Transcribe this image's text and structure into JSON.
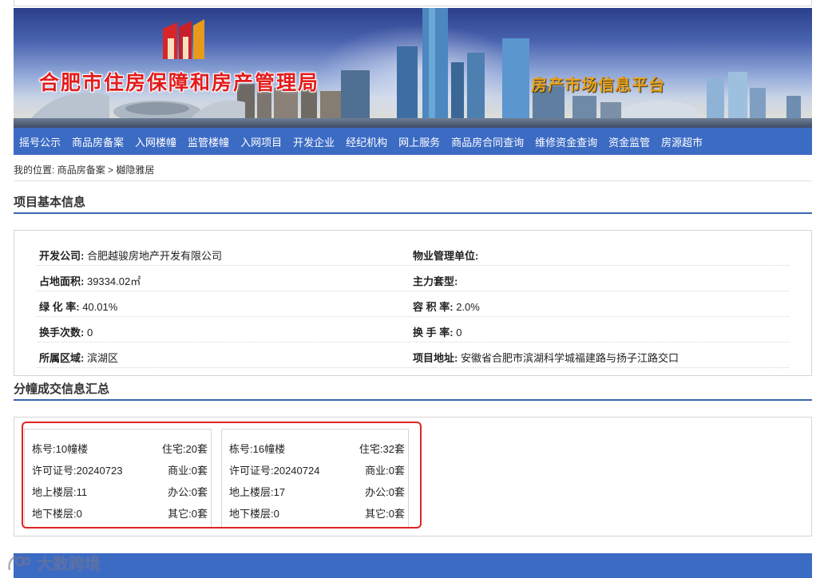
{
  "banner": {
    "title": "合肥市住房保障和房产管理局",
    "subtitle": "房产市场信息平台"
  },
  "nav": [
    "摇号公示",
    "商品房备案",
    "入网楼幢",
    "监管楼幢",
    "入网项目",
    "开发企业",
    "经纪机构",
    "网上服务",
    "商品房合同查询",
    "维修资金查询",
    "资金监管",
    "房源超市"
  ],
  "breadcrumb": {
    "prefix": "我的位置:",
    "item1": "商品房备案",
    "sep": ">",
    "item2": "樾隐雅居"
  },
  "section1": {
    "title": "项目基本信息"
  },
  "info": [
    {
      "left_label": "开发公司:",
      "left_value": "合肥越骏房地产开发有限公司",
      "right_label": "物业管理单位:",
      "right_value": ""
    },
    {
      "left_label": "占地面积:",
      "left_value": "39334.02㎡",
      "right_label": "主力套型:",
      "right_value": ""
    },
    {
      "left_label": "绿 化 率:",
      "left_value": "40.01%",
      "right_label": "容 积 率:",
      "right_value": "2.0%"
    },
    {
      "left_label": "换手次数:",
      "left_value": "0",
      "right_label": "换 手 率:",
      "right_value": "0"
    },
    {
      "left_label": "所属区域:",
      "left_value": "滨湖区",
      "right_label": "项目地址:",
      "right_value": "安徽省合肥市滨湖科学城福建路与扬子江路交口"
    }
  ],
  "section2": {
    "title": "分幢成交信息汇总"
  },
  "buildings": [
    {
      "rows": [
        {
          "k": "栋号:10幢楼",
          "v": "住宅:20套"
        },
        {
          "k": "许可证号:20240723",
          "v": "商业:0套"
        },
        {
          "k": "地上楼层:11",
          "v": "办公:0套"
        },
        {
          "k": "地下楼层:0",
          "v": "其它:0套"
        }
      ]
    },
    {
      "rows": [
        {
          "k": "栋号:16幢楼",
          "v": "住宅:32套"
        },
        {
          "k": "许可证号:20240724",
          "v": "商业:0套"
        },
        {
          "k": "地上楼层:17",
          "v": "办公:0套"
        },
        {
          "k": "地下楼层:0",
          "v": "其它:0套"
        }
      ]
    }
  ],
  "watermark": {
    "text": "大数跨境"
  },
  "colors": {
    "nav": "#3c6bc4",
    "rule": "#3b66ae",
    "title_red": "#e21c1c",
    "subtitle_gold": "#e9a21c",
    "highlight": "#e02424"
  }
}
